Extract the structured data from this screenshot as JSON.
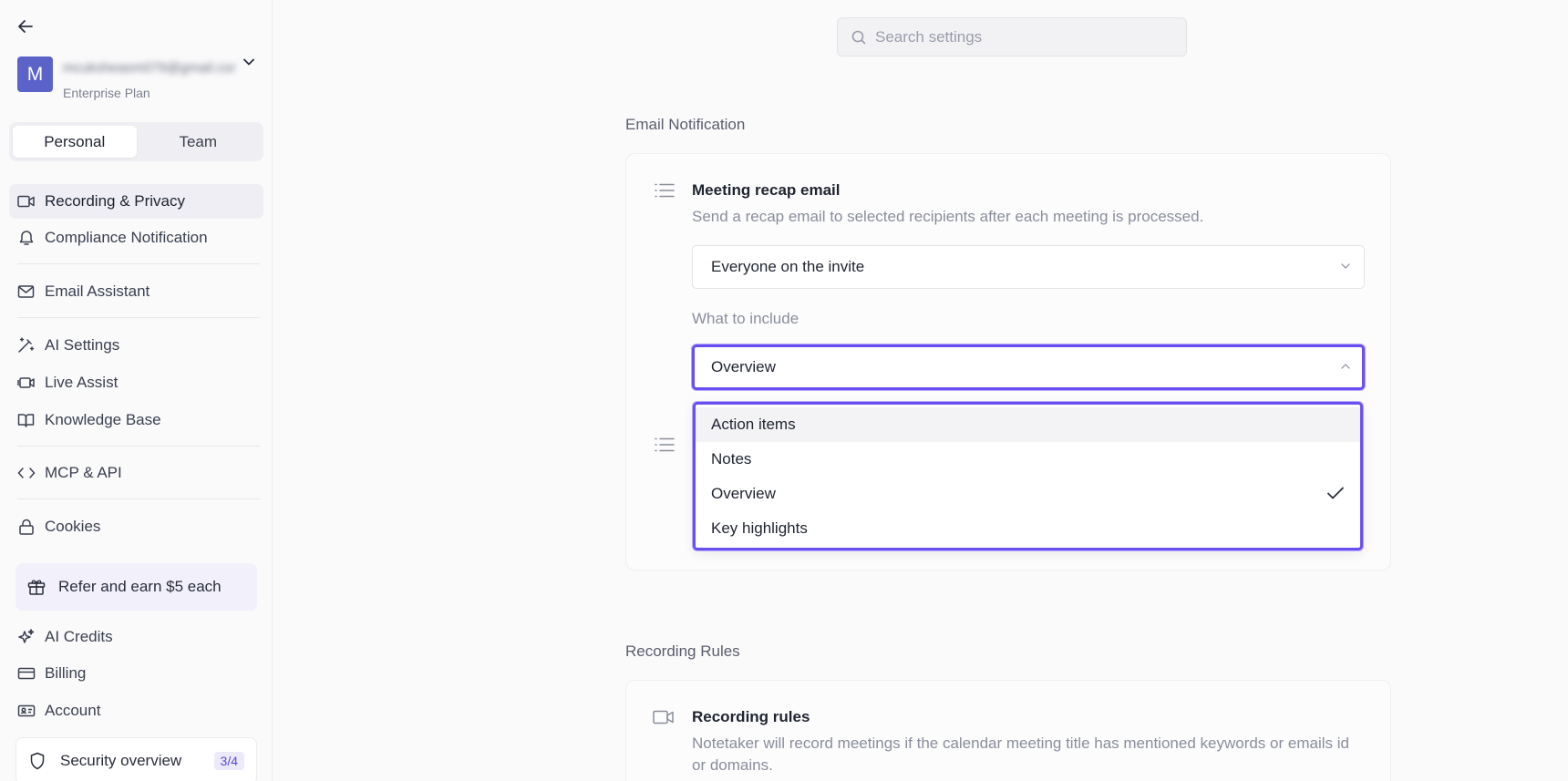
{
  "account": {
    "avatar_letter": "M",
    "email": "mcuksheasm079@gmail.com",
    "plan": "Enterprise Plan"
  },
  "tabs": {
    "personal": "Personal",
    "team": "Team",
    "active": "Personal"
  },
  "nav": {
    "recording_privacy": "Recording & Privacy",
    "compliance": "Compliance Notification",
    "email_assistant": "Email Assistant",
    "ai_settings": "AI Settings",
    "live_assist": "Live Assist",
    "knowledge_base": "Knowledge Base",
    "mcp_api": "MCP & API",
    "cookies": "Cookies",
    "ai_credits": "AI Credits",
    "billing": "Billing",
    "account": "Account"
  },
  "refer": {
    "label": "Refer and earn $5 each"
  },
  "security": {
    "label": "Security overview",
    "progress": "3/4"
  },
  "search": {
    "placeholder": "Search settings"
  },
  "email_notification": {
    "section_title": "Email Notification",
    "recap": {
      "title": "Meeting recap email",
      "description": "Send a recap email to selected recipients after each meeting is processed.",
      "recipients_value": "Everyone on the invite",
      "include_label": "What to include",
      "include_value": "Overview"
    },
    "dropdown_options": [
      {
        "label": "Action items",
        "checked": false
      },
      {
        "label": "Notes",
        "checked": false
      },
      {
        "label": "Overview",
        "checked": true
      },
      {
        "label": "Key highlights",
        "checked": false
      }
    ]
  },
  "recording_rules": {
    "section_title": "Recording Rules",
    "title": "Recording rules",
    "description": "Notetaker will record meetings if the calendar meeting title has mentioned keywords or emails id or domains."
  },
  "colors": {
    "accent": "#6a4ff0",
    "avatar": "#5b62c8"
  }
}
